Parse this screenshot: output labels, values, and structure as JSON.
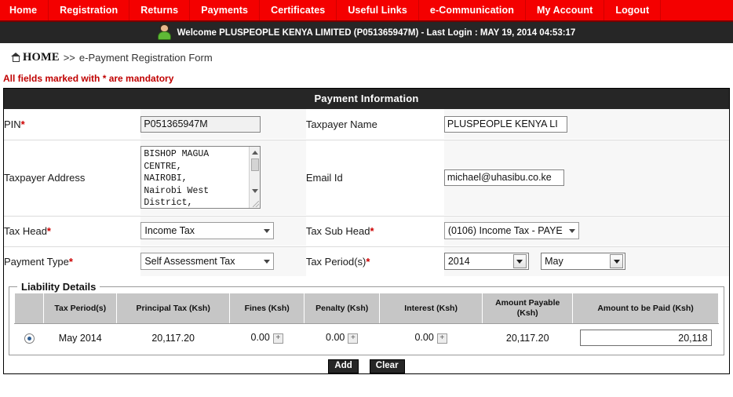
{
  "nav": {
    "items": [
      {
        "label": "Home"
      },
      {
        "label": "Registration"
      },
      {
        "label": "Returns"
      },
      {
        "label": "Payments"
      },
      {
        "label": "Certificates"
      },
      {
        "label": "Useful Links"
      },
      {
        "label": "e-Communication"
      },
      {
        "label": "My Account"
      },
      {
        "label": "Logout"
      }
    ],
    "accent_color": "#f40000"
  },
  "welcome": {
    "text": "Welcome PLUSPEOPLE KENYA LIMITED (P051365947M)  - Last Login : MAY 19, 2014 04:53:17",
    "avatar_icon": "user-avatar-icon"
  },
  "breadcrumb": {
    "home_icon": "home-icon",
    "home_label": "HOME",
    "separator": ">>",
    "current_page": "e-Payment Registration Form"
  },
  "notice": {
    "mandatory_text": "All fields marked with * are mandatory",
    "color": "#c00000"
  },
  "panel": {
    "title": "Payment Information"
  },
  "form": {
    "pin": {
      "label": "PIN",
      "required": "*",
      "value": "P051365947M",
      "placeholder": ""
    },
    "taxpayer_name": {
      "label": "Taxpayer Name",
      "required": "",
      "value": "PLUSPEOPLE KENYA LI",
      "placeholder": ""
    },
    "taxpayer_address": {
      "label": "Taxpayer Address",
      "required": "",
      "value": "BISHOP MAGUA\nCENTRE,\nNAIROBI,\nNairobi West\nDistrict,"
    },
    "email": {
      "label": "Email Id",
      "required": "",
      "value": "michael@uhasibu.co.ke",
      "placeholder": ""
    },
    "tax_head": {
      "label": "Tax Head",
      "required": "*",
      "value": "Income Tax"
    },
    "tax_sub_head": {
      "label": "Tax Sub Head",
      "required": "*",
      "value": "(0106) Income Tax - PAYE"
    },
    "payment_type": {
      "label": "Payment Type",
      "required": "*",
      "value": "Self Assessment Tax"
    },
    "tax_periods": {
      "label": "Tax Period(s)",
      "required": "*",
      "year_value": "2014",
      "month_value": "May"
    }
  },
  "liability": {
    "legend": "Liability Details",
    "columns": [
      "",
      "Tax Period(s)",
      "Principal Tax (Ksh)",
      "Fines (Ksh)",
      "Penalty (Ksh)",
      "Interest (Ksh)",
      "Amount Payable (Ksh)",
      "Amount to be Paid (Ksh)"
    ],
    "rows": [
      {
        "selected": true,
        "tax_period": "May 2014",
        "principal_tax": "20,117.20",
        "fines": "0.00",
        "penalty": "0.00",
        "interest": "0.00",
        "amount_payable": "20,117.20",
        "amount_to_be_paid": "20,118",
        "expand_icon": "plus-icon"
      }
    ]
  },
  "actions": {
    "add_label": "Add",
    "clear_label": "Clear"
  }
}
